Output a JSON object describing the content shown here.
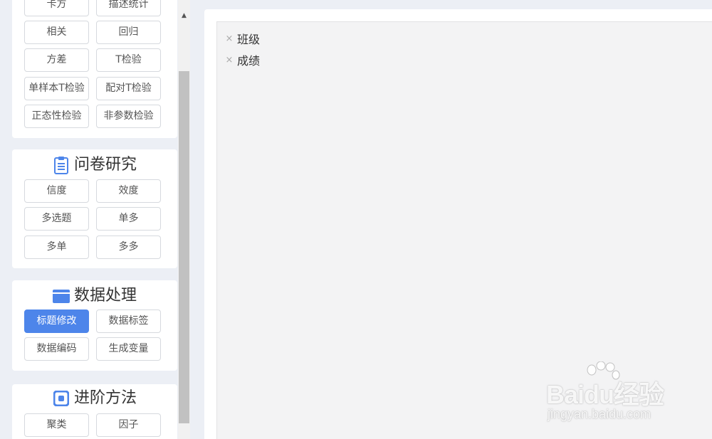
{
  "sidebar": {
    "card_stats": {
      "partial_labels": [
        "卡方",
        "描述统计"
      ],
      "buttons": [
        "相关",
        "回归",
        "方差",
        "T检验",
        "单样本T检验",
        "配对T检验",
        "正态性检验",
        "非参数检验"
      ]
    },
    "card_survey": {
      "title": "问卷研究",
      "icon": "clipboard-icon",
      "buttons": [
        "信度",
        "效度",
        "多选题",
        "单多",
        "多单",
        "多多"
      ]
    },
    "card_data": {
      "title": "数据处理",
      "icon": "folder-icon",
      "buttons": [
        "标题修改",
        "数据标签",
        "数据编码",
        "生成变量"
      ],
      "active_button": "标题修改"
    },
    "card_advanced": {
      "title": "进阶方法",
      "icon": "target-icon",
      "buttons": [
        "聚类",
        "因子"
      ]
    }
  },
  "main": {
    "variables": [
      "班级",
      "成绩"
    ],
    "remove_glyph": "×"
  },
  "watermark": {
    "brand": "Baidu经验",
    "url": "jingyan.baidu.com"
  },
  "colors": {
    "accent": "#4d85ea",
    "background": "#eceff5",
    "panel": "#ffffff",
    "drop_area": "#f3f3f4"
  }
}
